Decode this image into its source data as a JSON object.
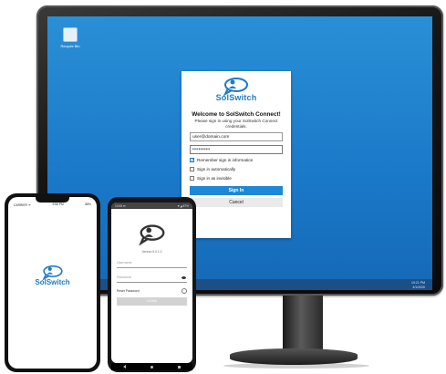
{
  "desktop": {
    "icon_label": "Recycle Bin",
    "clock_time": "10:21 PM",
    "clock_date": "4/1/2020"
  },
  "dialog": {
    "logo_text": "SolSwitch",
    "welcome": "Welcome to SolSwitch Connect!",
    "subtitle": "Please sign in using your SolSwitch Connect credentials.",
    "username_value": "user@domain.com",
    "password_value": "•••••••••",
    "remember_label": "Remember sign in information",
    "remember_checked": true,
    "auto_label": "Sign in automatically",
    "invisible_label": "Sign in as invisible",
    "signin_label": "Sign In",
    "cancel_label": "Cancel"
  },
  "iphone": {
    "carrier": "CARRIER ᯤ",
    "time": "9:56 PM",
    "battery": "88%",
    "logo_text": "SolSwitch"
  },
  "android": {
    "status_left": "10:08 ✉",
    "status_right": "▼◢ 87%",
    "version": "Version 5.0.1.0",
    "username_placeholder": "Username",
    "password_placeholder": "Password",
    "reset_label": "Reset Password",
    "login_label": "LOGIN"
  },
  "colors": {
    "accent": "#1e88d6",
    "desktop": "#1a78c8",
    "brand_text": "#1f7ac8"
  }
}
